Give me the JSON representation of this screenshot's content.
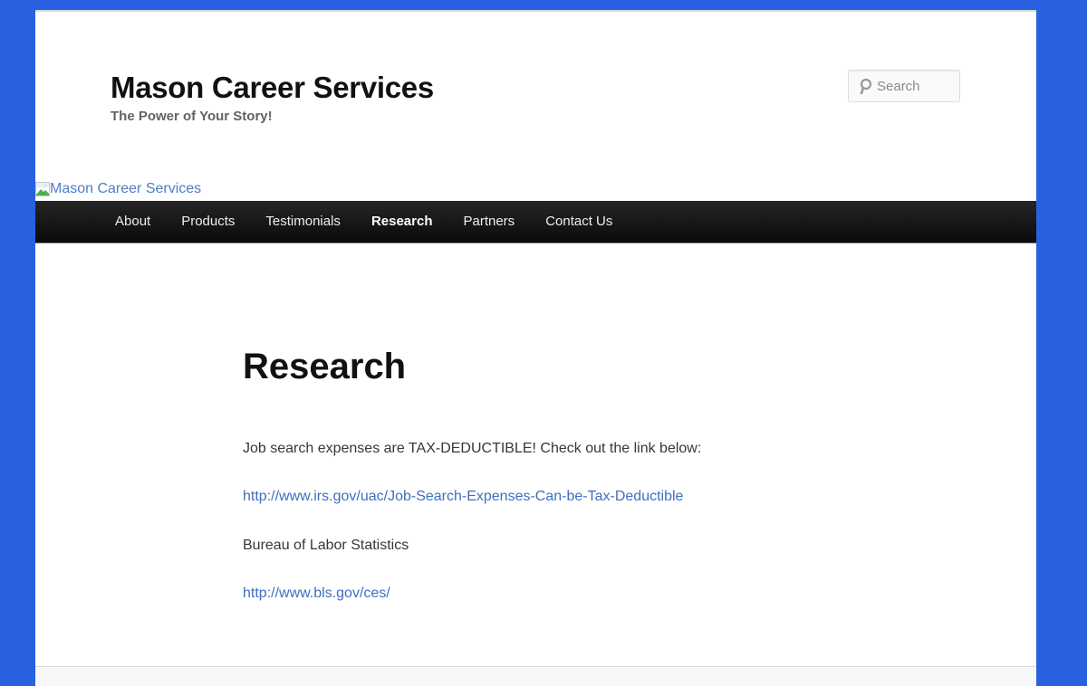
{
  "header": {
    "site_title": "Mason Career Services",
    "tagline": "The Power of Your Story!",
    "search_placeholder": "Search",
    "header_image_alt": "Mason Career Services"
  },
  "nav": {
    "items": [
      {
        "label": "About",
        "current": false
      },
      {
        "label": "Products",
        "current": false
      },
      {
        "label": "Testimonials",
        "current": false
      },
      {
        "label": "Research",
        "current": true
      },
      {
        "label": "Partners",
        "current": false
      },
      {
        "label": "Contact Us",
        "current": false
      }
    ]
  },
  "content": {
    "title": "Research",
    "paragraph_1": "Job search expenses are TAX-DEDUCTIBLE!  Check out the link below:",
    "link_1": "http://www.irs.gov/uac/Job-Search-Expenses-Can-be-Tax-Deductible",
    "paragraph_2": "Bureau of Labor Statistics",
    "link_2": "http://www.bls.gov/ces/"
  },
  "colors": {
    "background": "#2960e0",
    "link": "#3f6fbf",
    "nav_background": "#111111"
  },
  "icons": {
    "search": "search-icon",
    "header_image": "broken-image-icon"
  }
}
